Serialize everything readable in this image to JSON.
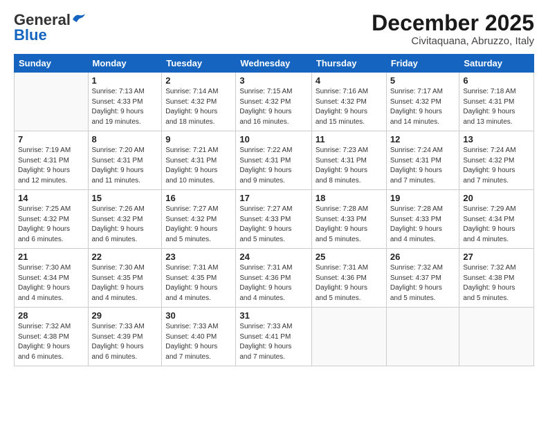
{
  "logo": {
    "general": "General",
    "blue": "Blue"
  },
  "title": {
    "month": "December 2025",
    "location": "Civitaquana, Abruzzo, Italy"
  },
  "headers": [
    "Sunday",
    "Monday",
    "Tuesday",
    "Wednesday",
    "Thursday",
    "Friday",
    "Saturday"
  ],
  "weeks": [
    [
      {
        "day": "",
        "info": ""
      },
      {
        "day": "1",
        "info": "Sunrise: 7:13 AM\nSunset: 4:33 PM\nDaylight: 9 hours\nand 19 minutes."
      },
      {
        "day": "2",
        "info": "Sunrise: 7:14 AM\nSunset: 4:32 PM\nDaylight: 9 hours\nand 18 minutes."
      },
      {
        "day": "3",
        "info": "Sunrise: 7:15 AM\nSunset: 4:32 PM\nDaylight: 9 hours\nand 16 minutes."
      },
      {
        "day": "4",
        "info": "Sunrise: 7:16 AM\nSunset: 4:32 PM\nDaylight: 9 hours\nand 15 minutes."
      },
      {
        "day": "5",
        "info": "Sunrise: 7:17 AM\nSunset: 4:32 PM\nDaylight: 9 hours\nand 14 minutes."
      },
      {
        "day": "6",
        "info": "Sunrise: 7:18 AM\nSunset: 4:31 PM\nDaylight: 9 hours\nand 13 minutes."
      }
    ],
    [
      {
        "day": "7",
        "info": "Sunrise: 7:19 AM\nSunset: 4:31 PM\nDaylight: 9 hours\nand 12 minutes."
      },
      {
        "day": "8",
        "info": "Sunrise: 7:20 AM\nSunset: 4:31 PM\nDaylight: 9 hours\nand 11 minutes."
      },
      {
        "day": "9",
        "info": "Sunrise: 7:21 AM\nSunset: 4:31 PM\nDaylight: 9 hours\nand 10 minutes."
      },
      {
        "day": "10",
        "info": "Sunrise: 7:22 AM\nSunset: 4:31 PM\nDaylight: 9 hours\nand 9 minutes."
      },
      {
        "day": "11",
        "info": "Sunrise: 7:23 AM\nSunset: 4:31 PM\nDaylight: 9 hours\nand 8 minutes."
      },
      {
        "day": "12",
        "info": "Sunrise: 7:24 AM\nSunset: 4:31 PM\nDaylight: 9 hours\nand 7 minutes."
      },
      {
        "day": "13",
        "info": "Sunrise: 7:24 AM\nSunset: 4:32 PM\nDaylight: 9 hours\nand 7 minutes."
      }
    ],
    [
      {
        "day": "14",
        "info": "Sunrise: 7:25 AM\nSunset: 4:32 PM\nDaylight: 9 hours\nand 6 minutes."
      },
      {
        "day": "15",
        "info": "Sunrise: 7:26 AM\nSunset: 4:32 PM\nDaylight: 9 hours\nand 6 minutes."
      },
      {
        "day": "16",
        "info": "Sunrise: 7:27 AM\nSunset: 4:32 PM\nDaylight: 9 hours\nand 5 minutes."
      },
      {
        "day": "17",
        "info": "Sunrise: 7:27 AM\nSunset: 4:33 PM\nDaylight: 9 hours\nand 5 minutes."
      },
      {
        "day": "18",
        "info": "Sunrise: 7:28 AM\nSunset: 4:33 PM\nDaylight: 9 hours\nand 5 minutes."
      },
      {
        "day": "19",
        "info": "Sunrise: 7:28 AM\nSunset: 4:33 PM\nDaylight: 9 hours\nand 4 minutes."
      },
      {
        "day": "20",
        "info": "Sunrise: 7:29 AM\nSunset: 4:34 PM\nDaylight: 9 hours\nand 4 minutes."
      }
    ],
    [
      {
        "day": "21",
        "info": "Sunrise: 7:30 AM\nSunset: 4:34 PM\nDaylight: 9 hours\nand 4 minutes."
      },
      {
        "day": "22",
        "info": "Sunrise: 7:30 AM\nSunset: 4:35 PM\nDaylight: 9 hours\nand 4 minutes."
      },
      {
        "day": "23",
        "info": "Sunrise: 7:31 AM\nSunset: 4:35 PM\nDaylight: 9 hours\nand 4 minutes."
      },
      {
        "day": "24",
        "info": "Sunrise: 7:31 AM\nSunset: 4:36 PM\nDaylight: 9 hours\nand 4 minutes."
      },
      {
        "day": "25",
        "info": "Sunrise: 7:31 AM\nSunset: 4:36 PM\nDaylight: 9 hours\nand 5 minutes."
      },
      {
        "day": "26",
        "info": "Sunrise: 7:32 AM\nSunset: 4:37 PM\nDaylight: 9 hours\nand 5 minutes."
      },
      {
        "day": "27",
        "info": "Sunrise: 7:32 AM\nSunset: 4:38 PM\nDaylight: 9 hours\nand 5 minutes."
      }
    ],
    [
      {
        "day": "28",
        "info": "Sunrise: 7:32 AM\nSunset: 4:38 PM\nDaylight: 9 hours\nand 6 minutes."
      },
      {
        "day": "29",
        "info": "Sunrise: 7:33 AM\nSunset: 4:39 PM\nDaylight: 9 hours\nand 6 minutes."
      },
      {
        "day": "30",
        "info": "Sunrise: 7:33 AM\nSunset: 4:40 PM\nDaylight: 9 hours\nand 7 minutes."
      },
      {
        "day": "31",
        "info": "Sunrise: 7:33 AM\nSunset: 4:41 PM\nDaylight: 9 hours\nand 7 minutes."
      },
      {
        "day": "",
        "info": ""
      },
      {
        "day": "",
        "info": ""
      },
      {
        "day": "",
        "info": ""
      }
    ]
  ]
}
